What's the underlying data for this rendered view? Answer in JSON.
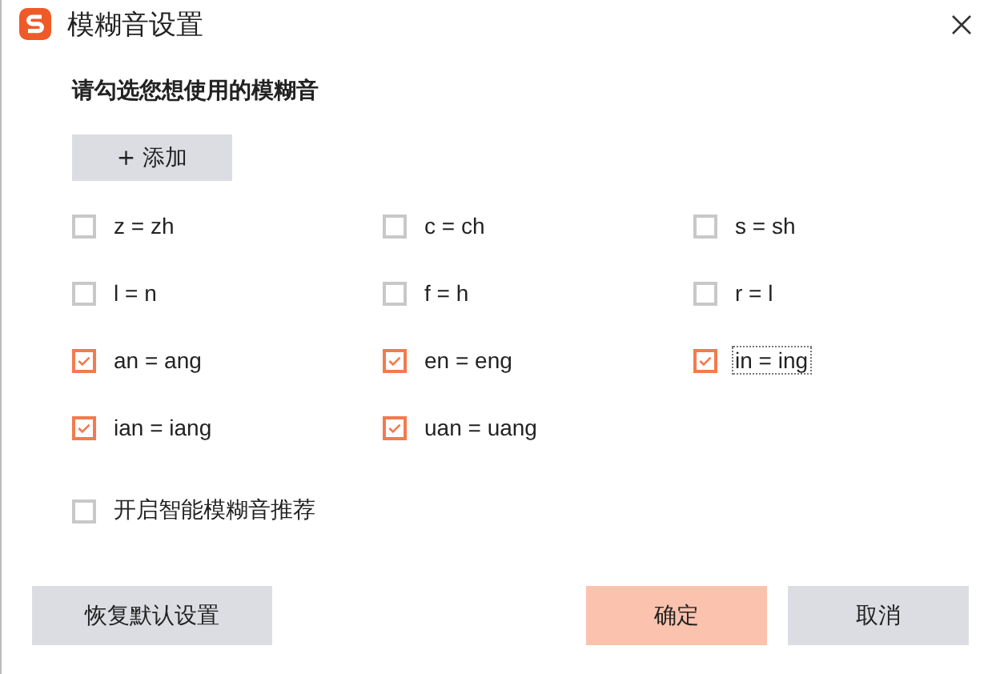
{
  "window": {
    "title": "模糊音设置"
  },
  "heading": "请勾选您想使用的模糊音",
  "add_button": "+ 添加",
  "options": [
    {
      "label": "z = zh",
      "checked": false,
      "focused": false
    },
    {
      "label": "c = ch",
      "checked": false,
      "focused": false
    },
    {
      "label": "s = sh",
      "checked": false,
      "focused": false
    },
    {
      "label": "l = n",
      "checked": false,
      "focused": false
    },
    {
      "label": "f = h",
      "checked": false,
      "focused": false
    },
    {
      "label": "r = l",
      "checked": false,
      "focused": false
    },
    {
      "label": "an = ang",
      "checked": true,
      "focused": false
    },
    {
      "label": "en = eng",
      "checked": true,
      "focused": false
    },
    {
      "label": "in = ing",
      "checked": true,
      "focused": true
    },
    {
      "label": "ian = iang",
      "checked": true,
      "focused": false
    },
    {
      "label": "uan = uang",
      "checked": true,
      "focused": false
    }
  ],
  "smart": {
    "label": "开启智能模糊音推荐",
    "checked": false
  },
  "buttons": [
    {
      "label": "恢复默认设置",
      "kind": "secondary"
    },
    {
      "label": "确定",
      "kind": "primary"
    },
    {
      "label": "取消",
      "kind": "secondary"
    }
  ]
}
